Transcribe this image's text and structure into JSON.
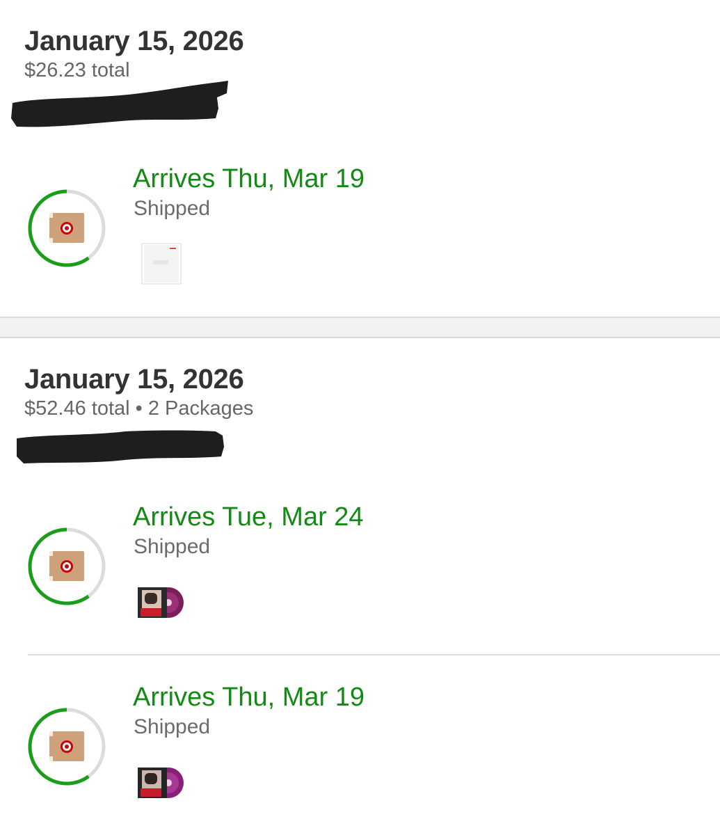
{
  "orders": [
    {
      "date": "January 15, 2026",
      "summary": "$26.23 total",
      "order_number_redacted": true,
      "packages": [
        {
          "arrival": "Arrives Thu, Mar 19",
          "status": "Shipped",
          "progress": 0.6,
          "item_thumbnail": "white-album-cover"
        }
      ]
    },
    {
      "date": "January 15, 2026",
      "summary": "$52.46 total • 2 Packages",
      "order_number_redacted": true,
      "packages": [
        {
          "arrival": "Arrives Tue, Mar 24",
          "status": "Shipped",
          "progress": 0.6,
          "item_thumbnail": "vinyl-album-cover-purple"
        },
        {
          "arrival": "Arrives Thu, Mar 19",
          "status": "Shipped",
          "progress": 0.6,
          "item_thumbnail": "vinyl-album-cover-purple"
        }
      ]
    }
  ],
  "colors": {
    "arrival_green": "#138a13",
    "ring_progress": "#1a9e1a",
    "ring_track": "#dcdcdc",
    "box_brown": "#cda27a",
    "target_red": "#cc0000"
  },
  "icons": {
    "package": "package-box-target-icon"
  }
}
